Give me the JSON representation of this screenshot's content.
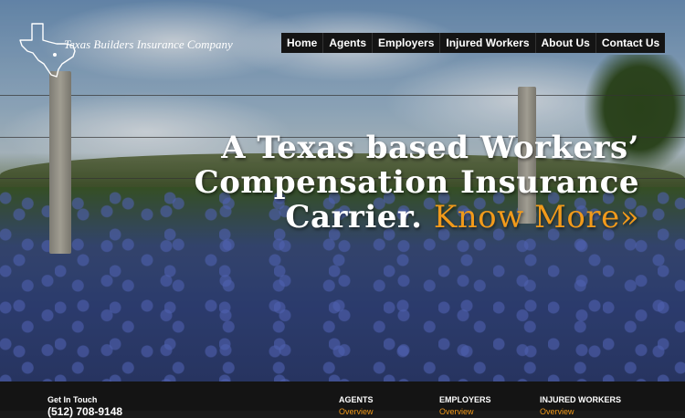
{
  "logo": {
    "text": "Texas Builders Insurance Company"
  },
  "nav": [
    {
      "label": "Home"
    },
    {
      "label": "Agents"
    },
    {
      "label": "Employers"
    },
    {
      "label": "Injured Workers"
    },
    {
      "label": "About Us"
    },
    {
      "label": "Contact Us"
    }
  ],
  "hero": {
    "line1": "A Texas based Workers’",
    "line2": "Compensation Insurance",
    "line3": "Carrier.",
    "cta": "Know More»"
  },
  "footer": {
    "get_in_touch": "Get In Touch",
    "phone": "(512) 708-9148",
    "columns": [
      {
        "heading": "AGENTS",
        "link": "Overview"
      },
      {
        "heading": "EMPLOYERS",
        "link": "Overview"
      },
      {
        "heading": "INJURED WORKERS",
        "link": "Overview"
      }
    ]
  },
  "colors": {
    "accent": "#f19a1b",
    "nav_bg": "#141414",
    "footer_bg": "#141414"
  }
}
